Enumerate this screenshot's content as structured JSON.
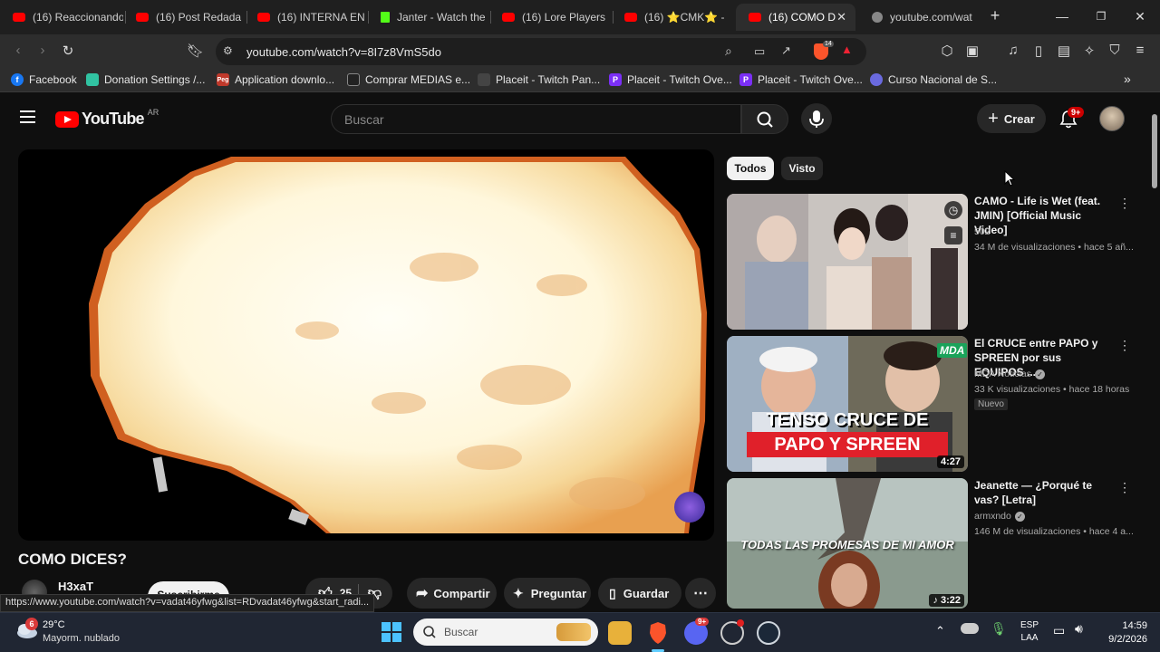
{
  "browser": {
    "tabs": [
      {
        "label": "(16) Reaccionando",
        "icon": "youtube-icon"
      },
      {
        "label": "(16) Post Redada",
        "icon": "youtube-icon"
      },
      {
        "label": "(16) INTERNA EN",
        "icon": "youtube-icon"
      },
      {
        "label": "Janter - Watch the",
        "icon": "kick-icon"
      },
      {
        "label": "(16) Lore Players",
        "icon": "youtube-icon"
      },
      {
        "label": "(16) ⭐CMK⭐ -",
        "icon": "youtube-icon"
      },
      {
        "label": "(16) COMO D",
        "icon": "youtube-icon",
        "active": true
      },
      {
        "label": "youtube.com/wat",
        "icon": "globe-icon"
      }
    ],
    "new_tab": "+",
    "url": "youtube.com/watch?v=8I7z8VmS5do",
    "shield_badge": "14",
    "bookmarks": [
      {
        "label": "Facebook",
        "icon": "facebook-icon",
        "color": "#1877f2"
      },
      {
        "label": "Donation Settings /...",
        "icon": "streamlabs-icon",
        "color": "#31c3a2"
      },
      {
        "label": "Application downlo...",
        "icon": "peg-icon",
        "color": "#c0392b"
      },
      {
        "label": "Comprar MEDIAS e...",
        "icon": "medias-icon",
        "color": "#222222"
      },
      {
        "label": "Placeit - Twitch Pan...",
        "icon": "placeit-icon",
        "color": "#444444"
      },
      {
        "label": "Placeit - Twitch Ove...",
        "icon": "placeit-p-icon",
        "color": "#7b2ff7"
      },
      {
        "label": "Placeit - Twitch Ove...",
        "icon": "placeit-p-icon",
        "color": "#7b2ff7"
      },
      {
        "label": "Curso Nacional de S...",
        "icon": "shield-icon",
        "color": "#6a6adf"
      }
    ]
  },
  "youtube": {
    "logo_text": "YouTube",
    "country": "AR",
    "search_placeholder": "Buscar",
    "create_label": "Crear",
    "notif_badge": "9+",
    "chips": [
      "Todos",
      "Visto"
    ],
    "video": {
      "title": "COMO DICES?",
      "channel": "H3xaT",
      "subscribe": "Suscribirme",
      "likes": "25",
      "share": "Compartir",
      "ask": "Preguntar",
      "save": "Guardar"
    },
    "recommendations": [
      {
        "title": "CAMO - Life is Wet (feat. JMIN) [Official Music Video]",
        "channel": "502",
        "meta": "34 M de visualizaciones • hace 5 añ...",
        "duration": ""
      },
      {
        "title": "El CRUCE entre PAPO y SPREEN por sus EQUIPOS ...",
        "channel": "MDA Noticias",
        "meta": "33 K visualizaciones • hace 18 horas",
        "badge": "Nuevo",
        "duration": "4:27",
        "thumb_text_1": "TENSO CRUCE DE",
        "thumb_text_2": "PAPO Y SPREEN",
        "thumb_tag": "MDA"
      },
      {
        "title": "Jeanette — ¿Porqué te vas? [Letra]",
        "channel": "armxndo",
        "meta": "146 M de visualizaciones • hace 4 a...",
        "duration": "3:22",
        "thumb_text_1": "TODAS LAS PROMESAS DE MI AMOR"
      }
    ]
  },
  "status_url": "https://www.youtube.com/watch?v=vadat46yfwg&list=RDvadat46yfwg&start_radi...",
  "taskbar": {
    "weather_temp": "29°C",
    "weather_desc": "Mayorm. nublado",
    "weather_badge": "6",
    "search_placeholder": "Buscar",
    "lang_1": "ESP",
    "lang_2": "LAA",
    "time": "14:59",
    "date": "9/2/2026",
    "discord_badge": "9+"
  }
}
